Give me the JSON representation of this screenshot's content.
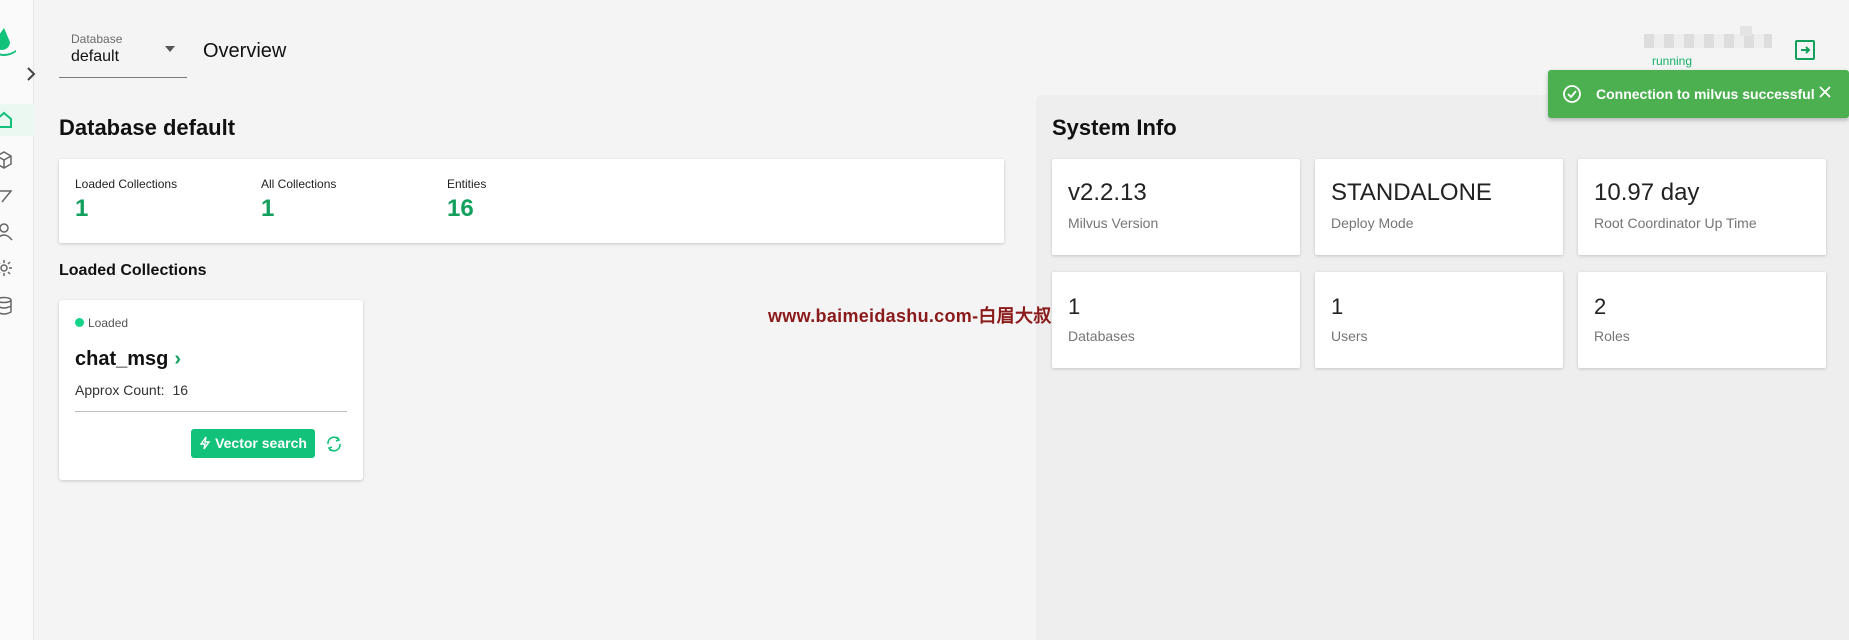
{
  "header": {
    "db_label": "Database",
    "db_value": "default",
    "page_title": "Overview",
    "status": "running"
  },
  "database": {
    "title": "Database default",
    "stats": [
      {
        "label": "Loaded Collections",
        "value": "1"
      },
      {
        "label": "All Collections",
        "value": "1"
      },
      {
        "label": "Entities",
        "value": "16"
      }
    ]
  },
  "loaded_collections": {
    "title": "Loaded Collections",
    "card": {
      "status": "Loaded",
      "name": "chat_msg",
      "count_label": "Approx Count:",
      "count_value": "16",
      "vector_search_label": "Vector search"
    }
  },
  "system_info": {
    "title": "System Info",
    "cards": [
      {
        "value": "v2.2.13",
        "label": "Milvus Version"
      },
      {
        "value": "STANDALONE",
        "label": "Deploy Mode"
      },
      {
        "value": "10.97 day",
        "label": "Root Coordinator Up Time"
      },
      {
        "value": "1",
        "label": "Databases"
      },
      {
        "value": "1",
        "label": "Users"
      },
      {
        "value": "2",
        "label": "Roles"
      }
    ]
  },
  "watermark": "www.baimeidashu.com-白眉大叔",
  "toast": {
    "message": "Connection to milvus successful"
  },
  "colors": {
    "accent": "#12c17a",
    "toast_bg": "#4caf50",
    "value_green": "#12a05c"
  },
  "icons": [
    "milvus-logo-icon",
    "chevron-right-icon",
    "home-icon",
    "cube-icon",
    "search-nav-icon",
    "user-icon",
    "system-icon",
    "database-icon",
    "logout-icon",
    "bolt-icon",
    "release-icon",
    "check-circle-icon",
    "close-icon"
  ]
}
